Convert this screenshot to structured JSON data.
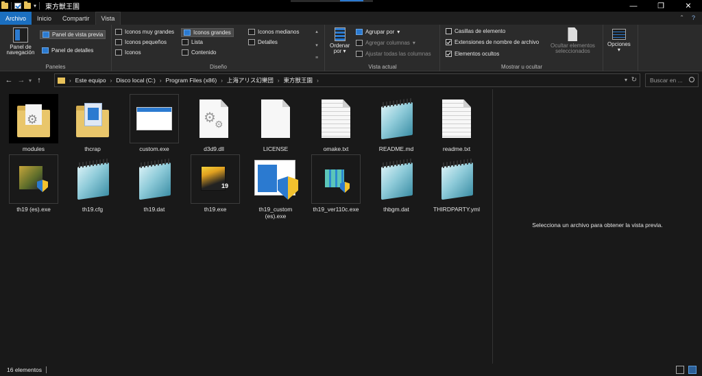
{
  "window": {
    "title": "東方獣王園",
    "minimize": "—",
    "maximize": "❐",
    "close": "✕"
  },
  "tabs": [
    {
      "label": "Archivo"
    },
    {
      "label": "Inicio"
    },
    {
      "label": "Compartir"
    },
    {
      "label": "Vista"
    }
  ],
  "ribbon": {
    "panes": {
      "nav_pane_label_1": "Panel de",
      "nav_pane_label_2": "navegación",
      "preview_pane": "Panel de vista previa",
      "details_pane": "Panel de detalles",
      "group_label": "Paneles"
    },
    "layout": {
      "options": [
        "Iconos muy grandes",
        "Iconos grandes",
        "Iconos medianos",
        "Iconos pequeños",
        "Lista",
        "Detalles",
        "Iconos",
        "Contenido"
      ],
      "selected": "Iconos grandes",
      "group_label": "Diseño"
    },
    "current_view": {
      "sort_label_1": "Ordenar",
      "sort_label_2": "por",
      "group_by": "Agrupar por",
      "add_columns": "Agregar columnas",
      "fit_columns": "Ajustar todas las columnas",
      "group_label": "Vista actual"
    },
    "show_hide": {
      "item_checkboxes": "Casillas de elemento",
      "item_checkboxes_checked": false,
      "file_extensions": "Extensiones de nombre de archivo",
      "file_extensions_checked": true,
      "hidden_items": "Elementos ocultos",
      "hidden_items_checked": true,
      "hide_selected_1": "Ocultar elementos",
      "hide_selected_2": "seleccionados",
      "group_label": "Mostrar u ocultar"
    },
    "options": {
      "label": "Opciones"
    }
  },
  "address": {
    "breadcrumbs": [
      "Este equipo",
      "Disco local (C:)",
      "Program Files (x86)",
      "上海アリス幻樂団",
      "東方獣王園"
    ]
  },
  "search": {
    "placeholder": "Buscar en ..."
  },
  "files": [
    {
      "name": "modules",
      "icon": "folder-gear-icon"
    },
    {
      "name": "thcrap",
      "icon": "folder-doc-icon"
    },
    {
      "name": "custom.exe",
      "icon": "window-app-icon"
    },
    {
      "name": "d3d9.dll",
      "icon": "dll-gear-icon"
    },
    {
      "name": "LICENSE",
      "icon": "blank-file-icon"
    },
    {
      "name": "omake.txt",
      "icon": "text-file-icon"
    },
    {
      "name": "README.md",
      "icon": "notepad-icon"
    },
    {
      "name": "readme.txt",
      "icon": "text-file-icon"
    },
    {
      "name": "th19 (es).exe",
      "icon": "game-shield-icon"
    },
    {
      "name": "th19.cfg",
      "icon": "notepad-icon"
    },
    {
      "name": "th19.dat",
      "icon": "notepad-icon"
    },
    {
      "name": "th19.exe",
      "icon": "game-icon"
    },
    {
      "name": "th19_custom (es).exe",
      "icon": "app-shield-icon"
    },
    {
      "name": "th19_ver110c.exe",
      "icon": "installer-shield-icon"
    },
    {
      "name": "thbgm.dat",
      "icon": "notepad-icon"
    },
    {
      "name": "THIRDPARTY.yml",
      "icon": "notepad-icon"
    }
  ],
  "game_icon_number": "19",
  "preview": {
    "message": "Selecciona un archivo para obtener la vista previa."
  },
  "status": {
    "count": "16 elementos"
  },
  "colors": {
    "accent": "#2b7ad0",
    "background": "#191919",
    "ribbon": "#2b2b2b",
    "folder": "#e9c66b"
  }
}
